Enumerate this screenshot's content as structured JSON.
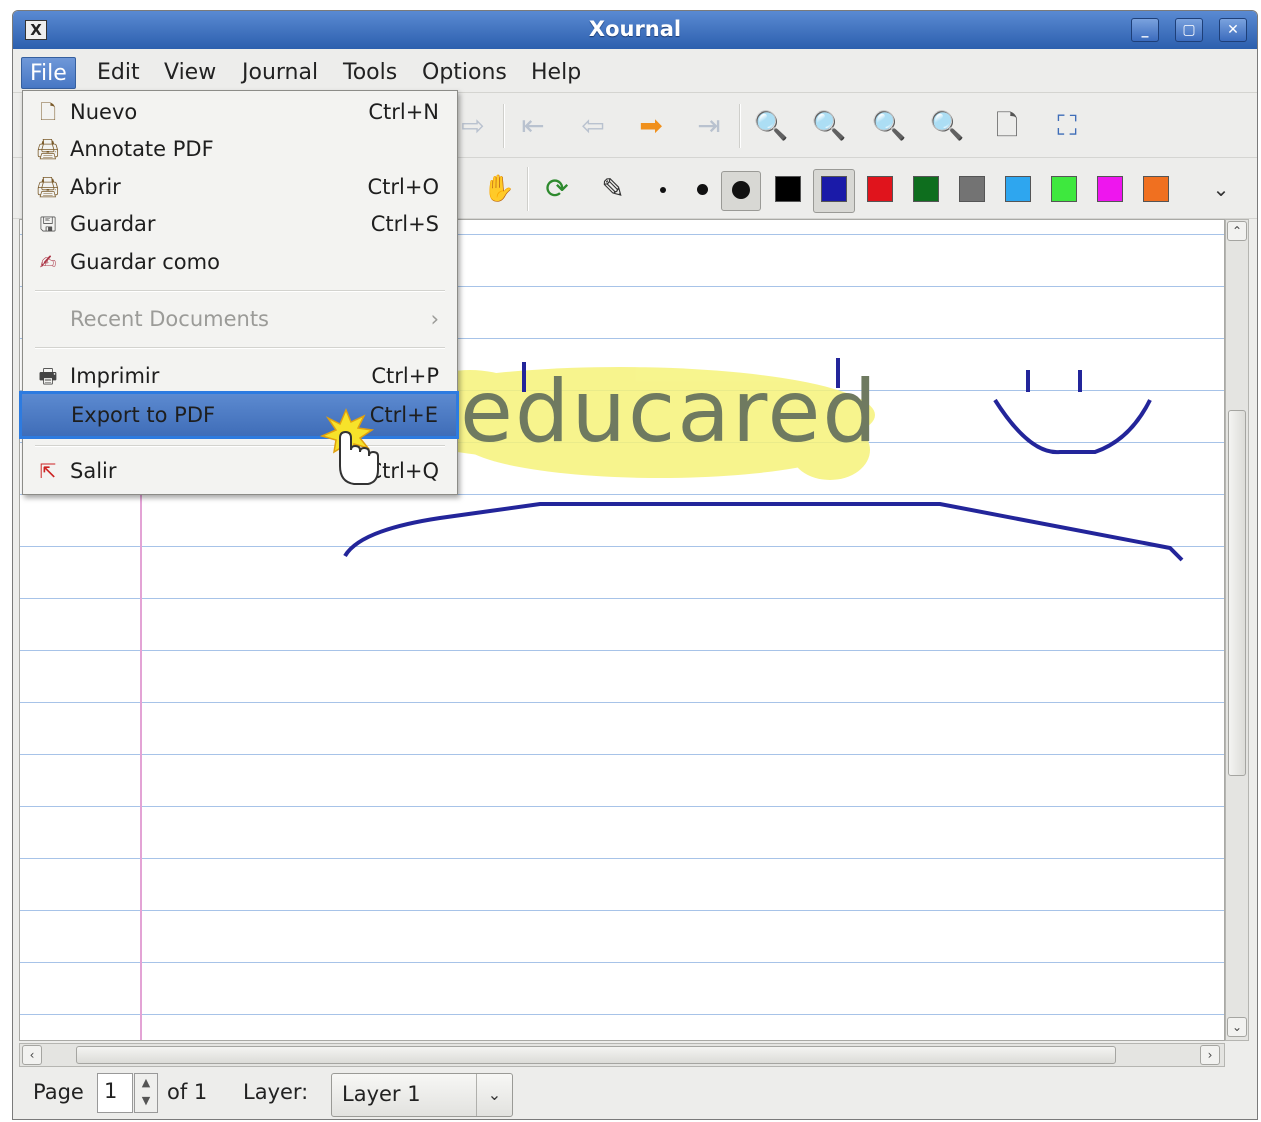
{
  "window": {
    "title": "Xournal"
  },
  "menubar": {
    "items": [
      "File",
      "Edit",
      "View",
      "Journal",
      "Tools",
      "Options",
      "Help"
    ],
    "active": "File"
  },
  "file_menu": {
    "items": [
      {
        "label": "Nuevo",
        "shortcut": "Ctrl+N",
        "icon": "new-document-icon"
      },
      {
        "label": "Annotate PDF",
        "shortcut": "",
        "icon": "annotate-pdf-icon"
      },
      {
        "label": "Abrir",
        "shortcut": "Ctrl+O",
        "icon": "open-folder-icon"
      },
      {
        "label": "Guardar",
        "shortcut": "Ctrl+S",
        "icon": "save-icon"
      },
      {
        "label": "Guardar como",
        "shortcut": "",
        "icon": "save-as-icon"
      },
      {
        "label": "Recent Documents",
        "shortcut": "",
        "icon": "",
        "disabled": true
      },
      {
        "label": "Imprimir",
        "shortcut": "Ctrl+P",
        "icon": "printer-icon"
      },
      {
        "label": "Export to PDF",
        "shortcut": "Ctrl+E",
        "icon": "",
        "highlighted": true
      },
      {
        "label": "Salir",
        "shortcut": "Ctrl+Q",
        "icon": "quit-icon"
      }
    ]
  },
  "canvas": {
    "highlighted_word": "educared"
  },
  "pen_colors": [
    "#000000",
    "#1a1aa8",
    "#e0141c",
    "#0e6e1e",
    "#737373",
    "#2ea6ef",
    "#3ee83e",
    "#ee16ee",
    "#f07020"
  ],
  "statusbar": {
    "page_label": "Page",
    "page_value": "1",
    "page_of": "of 1",
    "layer_label": "Layer:",
    "layer_value": "Layer 1"
  }
}
